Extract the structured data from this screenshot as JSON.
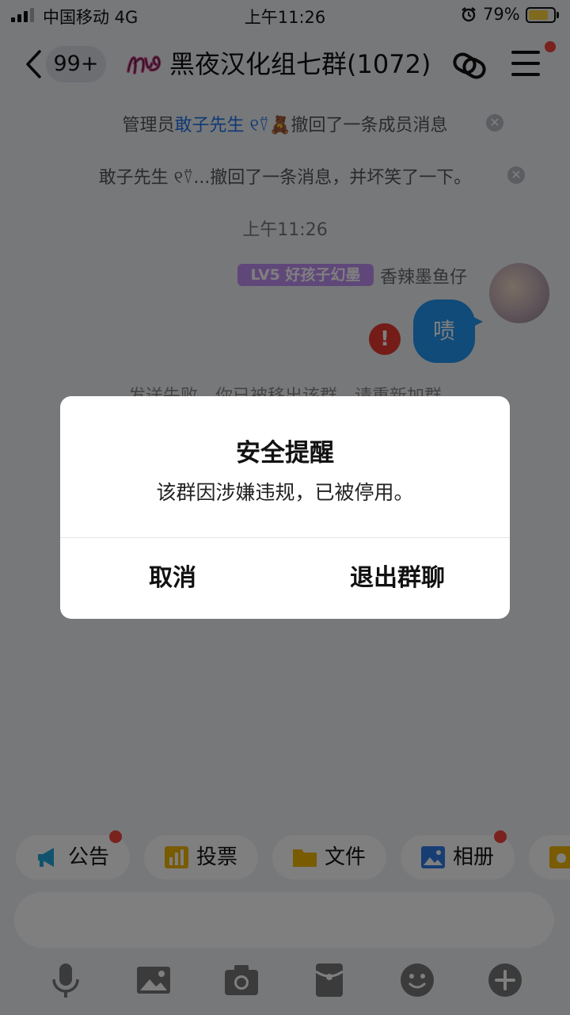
{
  "status_bar": {
    "carrier": "中国移动 4G",
    "time": "上午11:26",
    "battery": "79%",
    "battery_level": 0.79
  },
  "nav": {
    "unread_badge": "99+",
    "group_title": "黑夜汉化组七群(1072)"
  },
  "chat": {
    "sys_msg_1": {
      "prefix": "管理员",
      "name": "敢子先生 ୧⍢",
      "suffix": "🧸撤回了一条成员消息"
    },
    "sys_msg_2": "敢子先生 ୧⍢...撤回了一条消息，并坏笑了一下。",
    "timestamp": "上午11:26",
    "level_tag": "LV5 好孩子幻墨",
    "sender": "香辣墨鱼仔",
    "bubble_text": "啧",
    "fail_notice": "发送失败，你已被移出该群，请重新加群"
  },
  "shortcuts": [
    {
      "label": "公告",
      "icon": "megaphone-icon",
      "dot": true
    },
    {
      "label": "投票",
      "icon": "chart-bars-icon",
      "dot": false
    },
    {
      "label": "文件",
      "icon": "folder-icon",
      "dot": false
    },
    {
      "label": "相册",
      "icon": "photo-icon",
      "dot": true
    }
  ],
  "toolbar_icons": [
    "microphone-icon",
    "image-icon",
    "camera-icon",
    "red-envelope-icon",
    "emoji-icon",
    "plus-icon"
  ],
  "dialog": {
    "title": "安全提醒",
    "message": "该群因涉嫌违规，已被停用。",
    "cancel": "取消",
    "exit": "退出群聊"
  },
  "colors": {
    "accent_blue": "#2196f3",
    "alert_red": "#e8382e",
    "badge_red": "#f2453d",
    "level_purple": "#c08ef5",
    "battery_yellow": "#ffd43b"
  }
}
